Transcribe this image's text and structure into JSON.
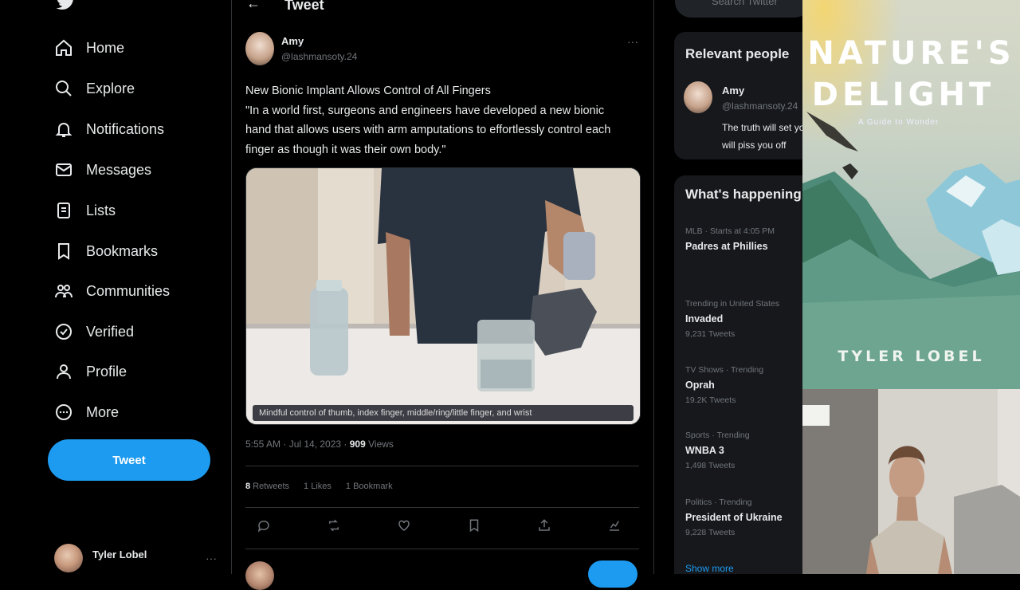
{
  "nav": {
    "items": [
      {
        "label": "Home",
        "icon": "home-icon"
      },
      {
        "label": "Explore",
        "icon": "search-icon"
      },
      {
        "label": "Notifications",
        "icon": "bell-icon"
      },
      {
        "label": "Messages",
        "icon": "mail-icon"
      },
      {
        "label": "Lists",
        "icon": "list-icon"
      },
      {
        "label": "Bookmarks",
        "icon": "bookmark-icon"
      },
      {
        "label": "Communities",
        "icon": "people-icon"
      },
      {
        "label": "Verified",
        "icon": "verified-icon"
      },
      {
        "label": "Profile",
        "icon": "person-icon"
      },
      {
        "label": "More",
        "icon": "more-circle-icon"
      }
    ],
    "tweet_button": "Tweet",
    "account_name": "Tyler Lobel"
  },
  "main": {
    "header_title": "Tweet",
    "author_name": "Amy",
    "author_handle": "@lashmansoty.24",
    "tweet_lines": [
      "New Bionic Implant Allows Control of All Fingers",
      "\"In a world first, surgeons and engineers have developed a new bionic",
      "hand that allows users with arm amputations to effortlessly control each",
      "finger as though it was their own body.\""
    ],
    "media_caption": "Mindful control of thumb, index finger, middle/ring/little finger, and wrist",
    "meta_time": "5:55 AM · Jul 14, 2023 · ",
    "meta_views_count": "909",
    "meta_views_label": " Views",
    "stats": [
      {
        "count": "8",
        "label": " Retweets"
      },
      {
        "count": "",
        "label": "1 Likes"
      },
      {
        "count": "",
        "label": "1 Bookmark"
      }
    ]
  },
  "sidebar": {
    "search_placeholder": "Search Twitter",
    "relevant_title": "Relevant people",
    "relevant_name": "Amy",
    "relevant_handle": "@lashmansoty.24",
    "relevant_bio_lines": [
      "The truth will set you",
      "will piss you off"
    ],
    "happening_title": "What's happening",
    "trends": [
      {
        "ctx": "MLB · Starts at 4:05 PM",
        "name": "Padres at Phillies",
        "count": ""
      },
      {
        "ctx": "Trending in United States",
        "name": "Invaded",
        "count": "9,231 Tweets"
      },
      {
        "ctx": "TV Shows · Trending",
        "name": "Oprah",
        "count": "19.2K Tweets"
      },
      {
        "ctx": "Sports · Trending",
        "name": "WNBA 3",
        "count": "1,498 Tweets"
      },
      {
        "ctx": "Politics · Trending",
        "name": "President of Ukraine",
        "count": "9,228 Tweets"
      }
    ],
    "show_more": "Show more"
  },
  "book": {
    "title_line1": "NATURE'S",
    "title_line2": "DELIGHT",
    "subtitle": "A Guide to Wonder",
    "author": "TYLER LOBEL"
  },
  "colors": {
    "accent": "#1d9bf0",
    "background": "#000000",
    "panel": "#16181c"
  }
}
